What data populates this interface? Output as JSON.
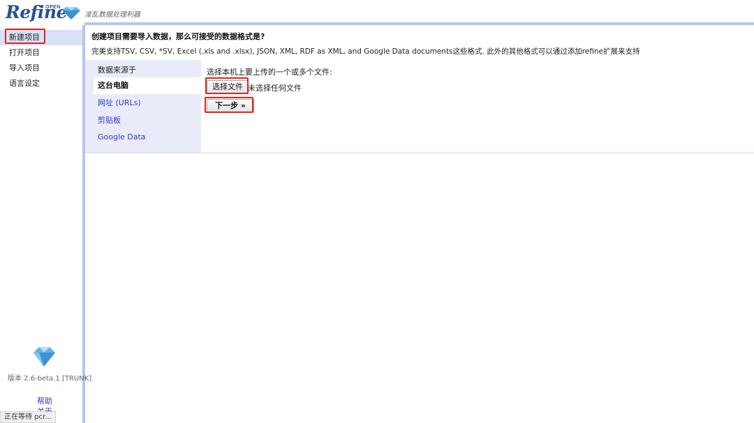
{
  "header": {
    "logo_text": "Refine",
    "logo_superscript": "OPEN",
    "slogan": "凌乱数据处理利器"
  },
  "nav": {
    "items": [
      {
        "label": "新建项目",
        "selected": true
      },
      {
        "label": "打开项目"
      },
      {
        "label": "导入项目"
      },
      {
        "label": "语言设定"
      }
    ],
    "version": "版本 2.6-beta.1 [TRUNK]",
    "help": "帮助",
    "about": "关于"
  },
  "status_bar": "正在等待 pcr...",
  "main": {
    "title": "创建项目需要导入数据，那么可接受的数据格式是?",
    "description": "完美支持TSV, CSV, *SV, Excel (.xls and .xlsx), JSON, XML, RDF as XML, and Google Data documents这些格式. 此外的其他格式可以通过添加refine扩展来支持",
    "sources_heading": "数据来源于",
    "sources": [
      {
        "label": "这台电脑",
        "active": true
      },
      {
        "label": "网址 (URLs)"
      },
      {
        "label": "剪贴板"
      },
      {
        "label": "Google Data"
      }
    ],
    "choose_label": "选择本机上要上传的一个或多个文件:",
    "file_button": "选择文件",
    "no_file": "未选择任何文件",
    "next_button": "下一步 »"
  },
  "colors": {
    "accent": "#b5c6ed",
    "highlight": "#e2231a",
    "link": "#3333cc"
  }
}
